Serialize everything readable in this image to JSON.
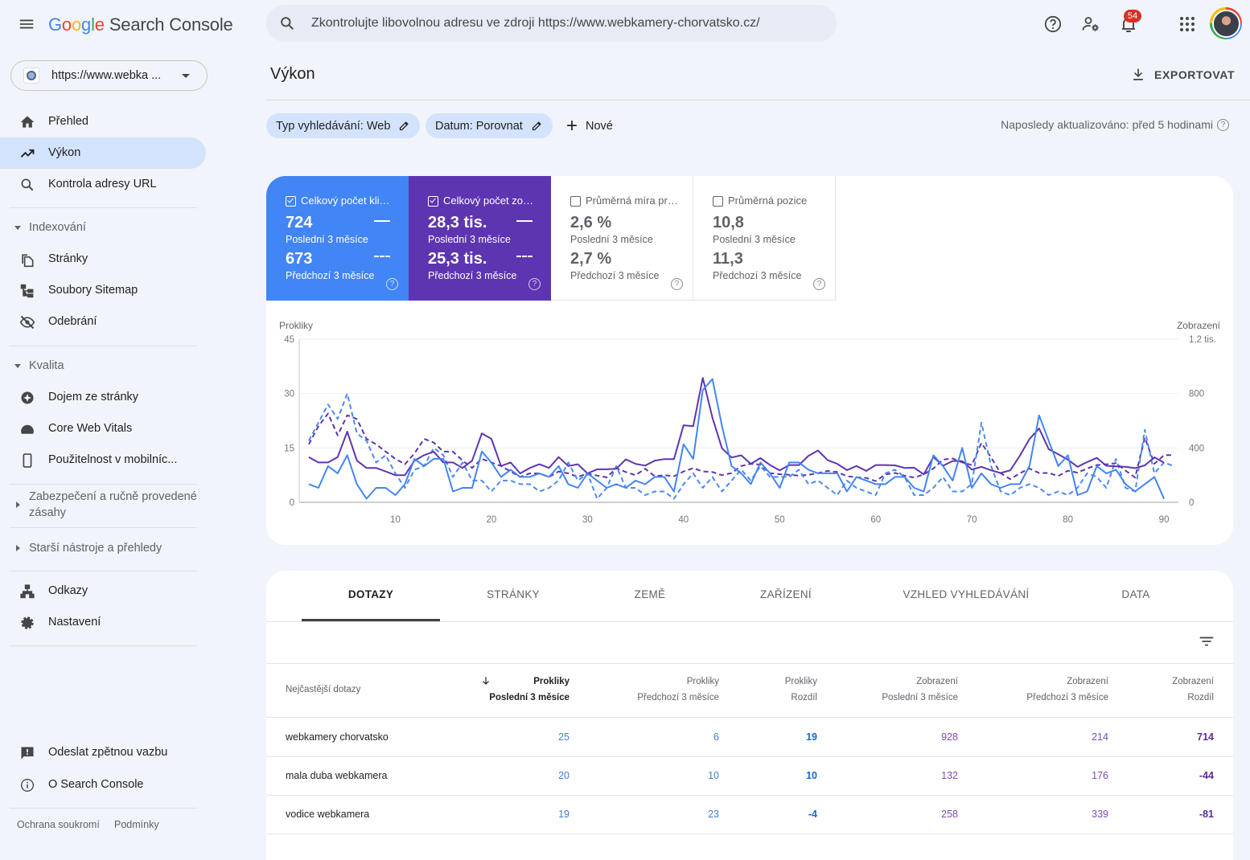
{
  "app": {
    "brand": "Google",
    "brand_colors": [
      "#4285f4",
      "#ea4335",
      "#fbbc05",
      "#4285f4",
      "#34a853",
      "#ea4335"
    ],
    "product": "Search Console"
  },
  "search": {
    "placeholder": "Zkontrolujte libovolnou adresu ve zdroji https://www.webkamery-chorvatsko.cz/"
  },
  "topbar": {
    "notifications_count": "54",
    "icons": [
      "help-icon",
      "admin-settings-icon",
      "notifications-icon",
      "apps-icon",
      "account-avatar"
    ]
  },
  "property": {
    "label": "https://www.webka ..."
  },
  "sidebar": {
    "top": [
      {
        "label": "Přehled",
        "icon": "home-icon"
      },
      {
        "label": "Výkon",
        "icon": "trending-up-icon",
        "active": true
      },
      {
        "label": "Kontrola adresy URL",
        "icon": "search-icon"
      }
    ],
    "indexing": {
      "title": "Indexování",
      "items": [
        {
          "label": "Stránky",
          "icon": "pages-icon"
        },
        {
          "label": "Soubory Sitemap",
          "icon": "sitemap-icon"
        },
        {
          "label": "Odebrání",
          "icon": "eye-off-icon"
        }
      ]
    },
    "quality": {
      "title": "Kvalita",
      "items": [
        {
          "label": "Dojem ze stránky",
          "icon": "page-experience-icon"
        },
        {
          "label": "Core Web Vitals",
          "icon": "gauge-icon"
        },
        {
          "label": "Použitelnost v mobilníc...",
          "icon": "smartphone-icon"
        }
      ]
    },
    "security": {
      "title_line1": "Zabezpečení a ručně provedené",
      "title_line2": "zásahy"
    },
    "legacy": {
      "title": "Starší nástroje a přehledy"
    },
    "bottom": [
      {
        "label": "Odkazy",
        "icon": "links-icon"
      },
      {
        "label": "Nastavení",
        "icon": "settings-icon"
      }
    ],
    "extra": [
      {
        "label": "Odeslat zpětnou vazbu",
        "icon": "feedback-icon"
      },
      {
        "label": "O Search Console",
        "icon": "info-icon"
      }
    ],
    "footer": {
      "privacy": "Ochrana soukromí",
      "terms": "Podmínky"
    }
  },
  "page": {
    "title": "Výkon",
    "export_label": "EXPORTOVAT"
  },
  "filters": {
    "chips": [
      {
        "label": "Typ vyhledávání: Web"
      },
      {
        "label": "Datum: Porovnat"
      }
    ],
    "add_label": "Nové",
    "last_updated": "Naposledy aktualizováno: před 5 hodinami"
  },
  "metrics": [
    {
      "label": "Celkový počet kli…",
      "selected": true,
      "color": "#4285f4",
      "current_value": "724",
      "current_period": "Poslední 3 měsíce",
      "previous_value": "673",
      "previous_period": "Předchozí 3 měsíce"
    },
    {
      "label": "Celkový počet zo…",
      "selected": true,
      "color": "#5e35b1",
      "current_value": "28,3 tis.",
      "current_period": "Poslední 3 měsíce",
      "previous_value": "25,3 tis.",
      "previous_period": "Předchozí 3 měsíce"
    },
    {
      "label": "Průměrná míra pr…",
      "selected": false,
      "current_value": "2,6 %",
      "current_period": "Poslední 3 měsíce",
      "previous_value": "2,7 %",
      "previous_period": "Předchozí 3 měsíce"
    },
    {
      "label": "Průměrná pozice",
      "selected": false,
      "current_value": "10,8",
      "current_period": "Poslední 3 měsíce",
      "previous_value": "11,3",
      "previous_period": "Předchozí 3 měsíce"
    }
  ],
  "chart_data": {
    "type": "line",
    "title": "",
    "xlabel": "",
    "x": [
      1,
      2,
      3,
      4,
      5,
      6,
      7,
      8,
      9,
      10,
      11,
      12,
      13,
      14,
      15,
      16,
      17,
      18,
      19,
      20,
      21,
      22,
      23,
      24,
      25,
      26,
      27,
      28,
      29,
      30,
      31,
      32,
      33,
      34,
      35,
      36,
      37,
      38,
      39,
      40,
      41,
      42,
      43,
      44,
      45,
      46,
      47,
      48,
      49,
      50,
      51,
      52,
      53,
      54,
      55,
      56,
      57,
      58,
      59,
      60,
      61,
      62,
      63,
      64,
      65,
      66,
      67,
      68,
      69,
      70,
      71,
      72,
      73,
      74,
      75,
      76,
      77,
      78,
      79,
      80,
      81,
      82,
      83,
      84,
      85,
      86,
      87,
      88,
      89,
      90,
      91
    ],
    "xlim": [
      0,
      91.5
    ],
    "x_ticks": [
      10,
      20,
      30,
      40,
      50,
      60,
      70,
      80,
      90
    ],
    "grid": true,
    "y_left": {
      "label": "Prokliky",
      "lim": [
        0,
        45
      ],
      "ticks": [
        0,
        15,
        30,
        45
      ],
      "tick_labels": [
        "0",
        "15",
        "30",
        "45"
      ]
    },
    "y_right": {
      "label": "Zobrazení",
      "lim": [
        0,
        1200
      ],
      "ticks": [
        0,
        400,
        800,
        1200
      ],
      "tick_labels": [
        "0",
        "400",
        "800",
        "1,2 tis."
      ]
    },
    "series": [
      {
        "id": "impressions-previous",
        "name": "Zobrazení – Předchozí 3 měsíce",
        "axis": "right",
        "dashed": true,
        "color": "#5e35b1",
        "values": [
          427,
          560,
          653,
          493,
          640,
          613,
          467,
          427,
          373,
          320,
          280,
          360,
          467,
          440,
          373,
          373,
          307,
          253,
          320,
          293,
          267,
          227,
          187,
          213,
          213,
          187,
          227,
          213,
          187,
          213,
          197,
          184,
          251,
          223,
          200,
          247,
          192,
          200,
          192,
          227,
          251,
          227,
          223,
          200,
          215,
          267,
          283,
          277,
          215,
          207,
          203,
          196,
          203,
          215,
          231,
          223,
          192,
          184,
          180,
          156,
          206,
          216,
          196,
          182,
          206,
          249,
          314,
          323,
          294,
          274,
          437,
          331,
          214,
          171,
          214,
          249,
          216,
          216,
          194,
          233,
          218,
          249,
          274,
          280,
          288,
          233,
          182,
          476,
          284,
          347,
          347
        ]
      },
      {
        "id": "clicks-previous",
        "name": "Prokliky – Předchozí 3 měsíce",
        "axis": "left",
        "dashed": true,
        "color": "#4a8af4",
        "values": [
          17,
          22,
          27,
          23,
          30,
          19,
          17,
          11,
          13,
          8,
          4,
          9,
          10,
          15,
          13,
          7,
          11,
          6,
          6,
          3,
          6,
          6,
          5,
          5,
          3,
          4,
          6,
          11,
          6,
          8,
          1,
          4,
          10,
          4,
          4,
          2,
          3,
          3,
          1,
          5,
          8,
          4,
          7,
          3,
          6,
          9,
          6,
          10,
          7,
          7,
          7,
          9,
          5,
          6,
          4,
          2,
          6,
          4,
          3,
          2,
          8,
          9,
          7,
          2,
          2,
          4,
          7,
          3,
          3,
          5,
          22,
          10,
          3,
          2,
          4,
          5,
          4,
          2,
          3,
          2,
          4,
          8,
          7,
          4,
          12,
          4,
          3,
          20,
          8,
          11,
          10
        ]
      },
      {
        "id": "impressions-current",
        "name": "Zobrazení – Poslední 3 měsíce",
        "axis": "right",
        "dashed": false,
        "color": "#5e35b1",
        "values": [
          333,
          293,
          293,
          333,
          520,
          307,
          253,
          253,
          227,
          200,
          200,
          307,
          347,
          373,
          293,
          293,
          253,
          307,
          507,
          467,
          267,
          293,
          213,
          253,
          280,
          253,
          333,
          267,
          280,
          213,
          243,
          243,
          247,
          316,
          283,
          270,
          307,
          318,
          318,
          567,
          560,
          915,
          622,
          397,
          330,
          346,
          283,
          326,
          274,
          235,
          274,
          274,
          342,
          381,
          310,
          283,
          237,
          267,
          231,
          274,
          274,
          272,
          253,
          255,
          206,
          333,
          269,
          304,
          304,
          241,
          261,
          235,
          216,
          235,
          343,
          465,
          543,
          392,
          353,
          314,
          261,
          296,
          327,
          269,
          265,
          261,
          251,
          272,
          331,
          292
        ]
      },
      {
        "id": "clicks-current",
        "name": "Prokliky – Poslední 3 měsíce",
        "axis": "left",
        "dashed": false,
        "color": "#4285f4",
        "values": [
          5,
          4,
          10,
          8,
          13,
          5,
          1,
          4,
          4,
          2,
          5,
          12,
          10,
          12,
          12,
          3,
          4,
          4,
          14,
          11,
          7,
          9,
          7,
          7,
          8,
          7,
          10,
          5,
          4,
          8,
          6,
          4,
          5,
          4,
          6,
          5,
          7,
          7,
          3,
          16,
          12,
          31,
          34,
          21,
          10,
          8,
          5,
          11,
          8,
          4,
          11,
          11,
          9,
          8,
          8,
          8,
          3,
          7,
          6,
          5,
          5,
          7,
          7,
          4,
          3,
          13,
          10,
          6,
          15,
          4,
          8,
          5,
          4,
          5,
          5,
          10,
          24,
          17,
          10,
          13,
          2,
          3,
          10,
          8,
          9,
          5,
          3,
          5,
          7,
          1
        ]
      }
    ]
  },
  "table": {
    "tabs": [
      "DOTAZY",
      "STRÁNKY",
      "ZEMĚ",
      "ZAŘÍZENÍ",
      "VZHLED VYHLEDÁVÁNÍ",
      "DATA"
    ],
    "active_tab": "DOTAZY",
    "columns": [
      {
        "line1": "Nejčastější dotazy",
        "line2": ""
      },
      {
        "line1": "Prokliky",
        "line2": "Poslední 3 měsíce",
        "sorted": "descending"
      },
      {
        "line1": "Prokliky",
        "line2": "Předchozí 3 měsíce"
      },
      {
        "line1": "Prokliky",
        "line2": "Rozdíl"
      },
      {
        "line1": "Zobrazení",
        "line2": "Poslední 3 měsíce"
      },
      {
        "line1": "Zobrazení",
        "line2": "Předchozí 3 měsíce"
      },
      {
        "line1": "Zobrazení",
        "line2": "Rozdíl"
      }
    ],
    "rows": [
      {
        "query": "webkamery chorvatsko",
        "clicks_current": "25",
        "clicks_previous": "6",
        "clicks_diff": "19",
        "impr_current": "928",
        "impr_previous": "214",
        "impr_diff": "714"
      },
      {
        "query": "mala duba webkamera",
        "clicks_current": "20",
        "clicks_previous": "10",
        "clicks_diff": "10",
        "impr_current": "132",
        "impr_previous": "176",
        "impr_diff": "-44"
      },
      {
        "query": "vodice webkamera",
        "clicks_current": "19",
        "clicks_previous": "23",
        "clicks_diff": "-4",
        "impr_current": "258",
        "impr_previous": "339",
        "impr_diff": "-81"
      }
    ]
  }
}
